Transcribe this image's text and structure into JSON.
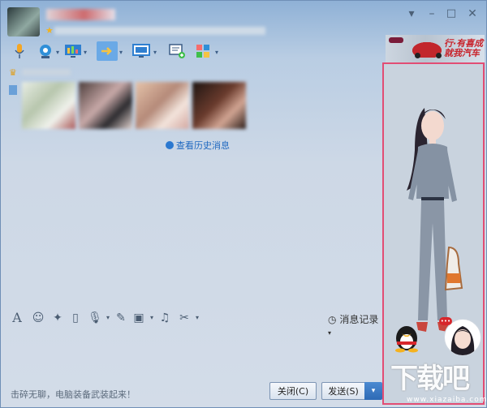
{
  "window": {
    "controls": [
      {
        "name": "menu-arrow-icon",
        "glyph": "▾"
      },
      {
        "name": "minimize-icon",
        "glyph": "–"
      },
      {
        "name": "maximize-icon",
        "glyph": "□"
      },
      {
        "name": "close-icon",
        "glyph": "✕"
      }
    ]
  },
  "toolbar": {
    "icons": [
      "microphone-icon",
      "camera-icon",
      "screen-share-icon",
      "file-transfer-icon",
      "remote-desktop-icon",
      "message-add-icon",
      "apps-icon"
    ]
  },
  "ad": {
    "text_line1": "行·有喜成",
    "text_line2": "就我汽车"
  },
  "chat": {
    "history_link": "查看历史消息"
  },
  "input_toolbar": {
    "icons": [
      "font-icon",
      "emoji-icon",
      "magic-icon",
      "shake-icon",
      "voice-icon",
      "image-edit-icon",
      "picture-icon",
      "music-icon",
      "screenshot-icon"
    ],
    "message_log_label": "消息记录"
  },
  "footer": {
    "status_text": "击碎无聊，电脑装备武装起来！",
    "close_button": "关闭(C)",
    "send_button": "发送(S)"
  },
  "watermark": {
    "text": "下载吧",
    "url": "www.xiazaiba.com"
  },
  "colors": {
    "highlight_border": "#e24d74",
    "link": "#1e68c0",
    "send_button": "#2e6ab5"
  }
}
